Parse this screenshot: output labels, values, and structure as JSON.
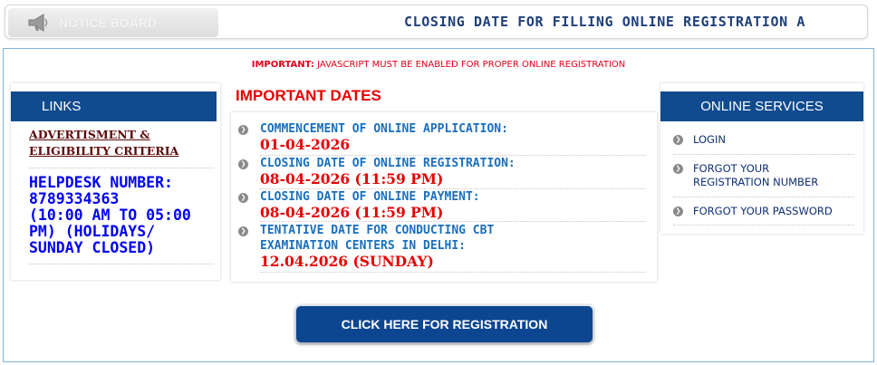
{
  "notice": {
    "tab_label": "NOTICE BOARD",
    "icon": "megaphone-icon",
    "scrolling_text": "CLOSING DATE FOR FILLING ONLINE REGISTRATION A"
  },
  "warning": {
    "prefix": "IMPORTANT:",
    "text": "JAVASCRIPT MUST BE ENABLED FOR PROPER ONLINE REGISTRATION"
  },
  "links": {
    "header": "LINKS",
    "advertisement": "ADVERTISMENT & ELIGIBILITY CRITERIA",
    "helpdesk_lines": [
      "HELPDESK NUMBER:",
      "8789334363",
      "(10:00 AM TO 05:00",
      "PM) (HOLIDAYS/",
      "SUNDAY CLOSED)"
    ]
  },
  "dates": {
    "title": "IMPORTANT DATES",
    "items": [
      {
        "label": "COMMENCEMENT OF ONLINE APPLICATION:",
        "value": "01-04-2026"
      },
      {
        "label": "CLOSING DATE OF ONLINE REGISTRATION:",
        "value": "08-04-2026 (11:59 PM)"
      },
      {
        "label": "CLOSING DATE OF ONLINE PAYMENT:",
        "value": "08-04-2026 (11:59 PM)"
      },
      {
        "label": "TENTATIVE DATE FOR CONDUCTING CBT",
        "label_line2": "EXAMINATION CENTERS IN DELHI:",
        "value": "12.04.2026 (SUNDAY)"
      }
    ]
  },
  "services": {
    "header": "ONLINE SERVICES",
    "items": [
      {
        "line1": "LOGIN",
        "line2": ""
      },
      {
        "line1": "FORGOT YOUR",
        "line2": "REGISTRATION NUMBER"
      },
      {
        "line1": "FORGOT YOUR PASSWORD",
        "line2": ""
      }
    ]
  },
  "register_button": "CLICK HERE FOR REGISTRATION",
  "colors": {
    "header_blue": "#104b8f",
    "date_label": "#1a6fbd",
    "date_value": "#e60000",
    "helpdesk": "#0000f2",
    "border": "#7fb3d9"
  }
}
